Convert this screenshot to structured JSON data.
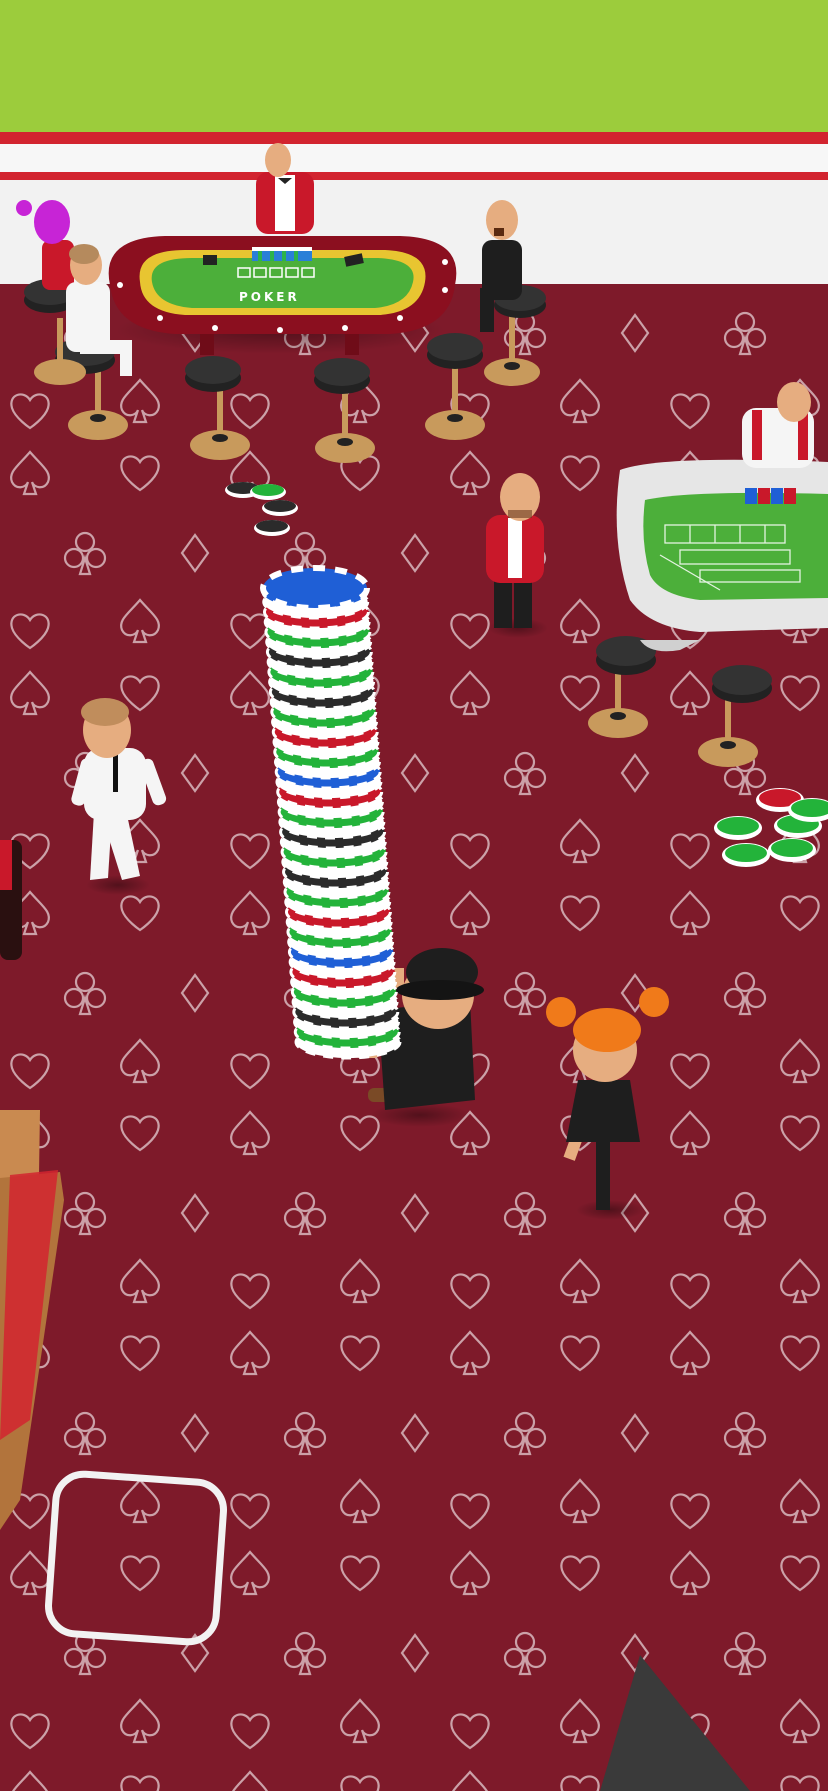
{
  "game": {
    "poker_table": {
      "label": "POKER",
      "felt_color": "#4caf3a",
      "rim_color": "#8b0f1f"
    },
    "craps_table": {
      "felt_color": "#4caf3a",
      "rim_color": "#e6e6e6"
    },
    "colors": {
      "sky": "#9ccc3c",
      "carpet": "#7e1a2a",
      "carpet_symbol": "#d8b9bf",
      "wall": "#f2f2f2",
      "wall_stripe": "#d2242f",
      "chip_blue": "#1f5fd6",
      "chip_green": "#23b33a",
      "chip_red": "#c9182a",
      "chip_black": "#2b2b2b",
      "chip_white": "#ffffff"
    },
    "chip_stack": {
      "pattern": [
        "blue",
        "white",
        "red",
        "white",
        "green",
        "white",
        "black",
        "white",
        "green",
        "white",
        "black",
        "white",
        "green",
        "white",
        "red",
        "white",
        "green",
        "white"
      ]
    },
    "characters": [
      "player-carrying-chips",
      "poker-dealer",
      "craps-dealer",
      "red-jacket-guard",
      "white-suit-guest",
      "orange-hair-guest",
      "pink-hair-guest",
      "seated-guest",
      "seated-black-guest"
    ],
    "joystick": {
      "icon": "joystick-ring-icon"
    }
  }
}
